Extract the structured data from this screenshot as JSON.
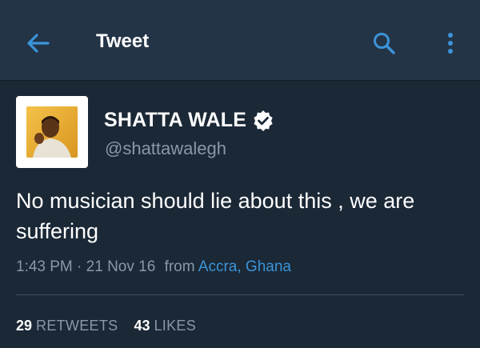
{
  "header": {
    "title": "Tweet",
    "back_icon": "arrow-left-icon",
    "search_icon": "search-icon",
    "more_icon": "more-vertical-icon"
  },
  "tweet": {
    "author": {
      "display_name": "SHATTA WALE",
      "handle": "@shattawalegh",
      "verified": true
    },
    "text": "No musician should lie about this , we are suffering",
    "time": "1:43 PM",
    "date": "21 Nov 16",
    "from_label": "from",
    "location": "Accra, Ghana",
    "retweets": {
      "count": "29",
      "label": "RETWEETS"
    },
    "likes": {
      "count": "43",
      "label": "LIKES"
    }
  },
  "colors": {
    "background": "#1b2836",
    "header": "#243447",
    "accent": "#3b94d9",
    "muted": "#8899a6"
  }
}
